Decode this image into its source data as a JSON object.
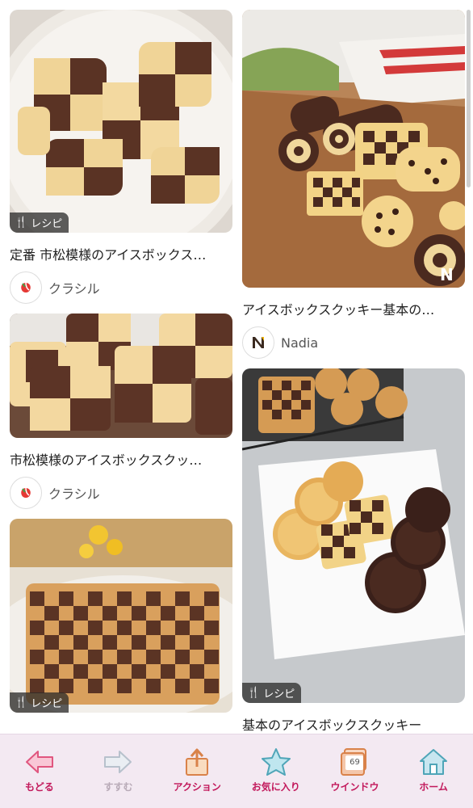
{
  "cards": [
    {
      "id": "c1",
      "title": "定番 市松模様のアイスボックス…",
      "source": "クラシル",
      "badge": "レシピ"
    },
    {
      "id": "c2",
      "title": "アイスボックスクッキー基本の…",
      "source": "Nadia",
      "badge": ""
    },
    {
      "id": "c3",
      "title": "市松模様のアイスボックスクッ…",
      "source": "クラシル",
      "badge": ""
    },
    {
      "id": "c4",
      "title": "",
      "source": "",
      "badge": "レシピ"
    },
    {
      "id": "c5",
      "title": "基本のアイスボックスクッキー",
      "source": "",
      "badge": "レシピ"
    }
  ],
  "toolbar": {
    "back": "もどる",
    "forward": "すすむ",
    "action": "アクション",
    "favorites": "お気に入り",
    "window": "ウインドウ",
    "window_count": "69",
    "home": "ホーム"
  },
  "colors": {
    "accent": "#c2185b",
    "toolbar_bg": "#f3e9f2"
  },
  "icons": [
    "fork-knife-icon",
    "back-arrow-icon",
    "forward-arrow-icon",
    "share-icon",
    "star-icon",
    "window-icon",
    "home-icon"
  ]
}
